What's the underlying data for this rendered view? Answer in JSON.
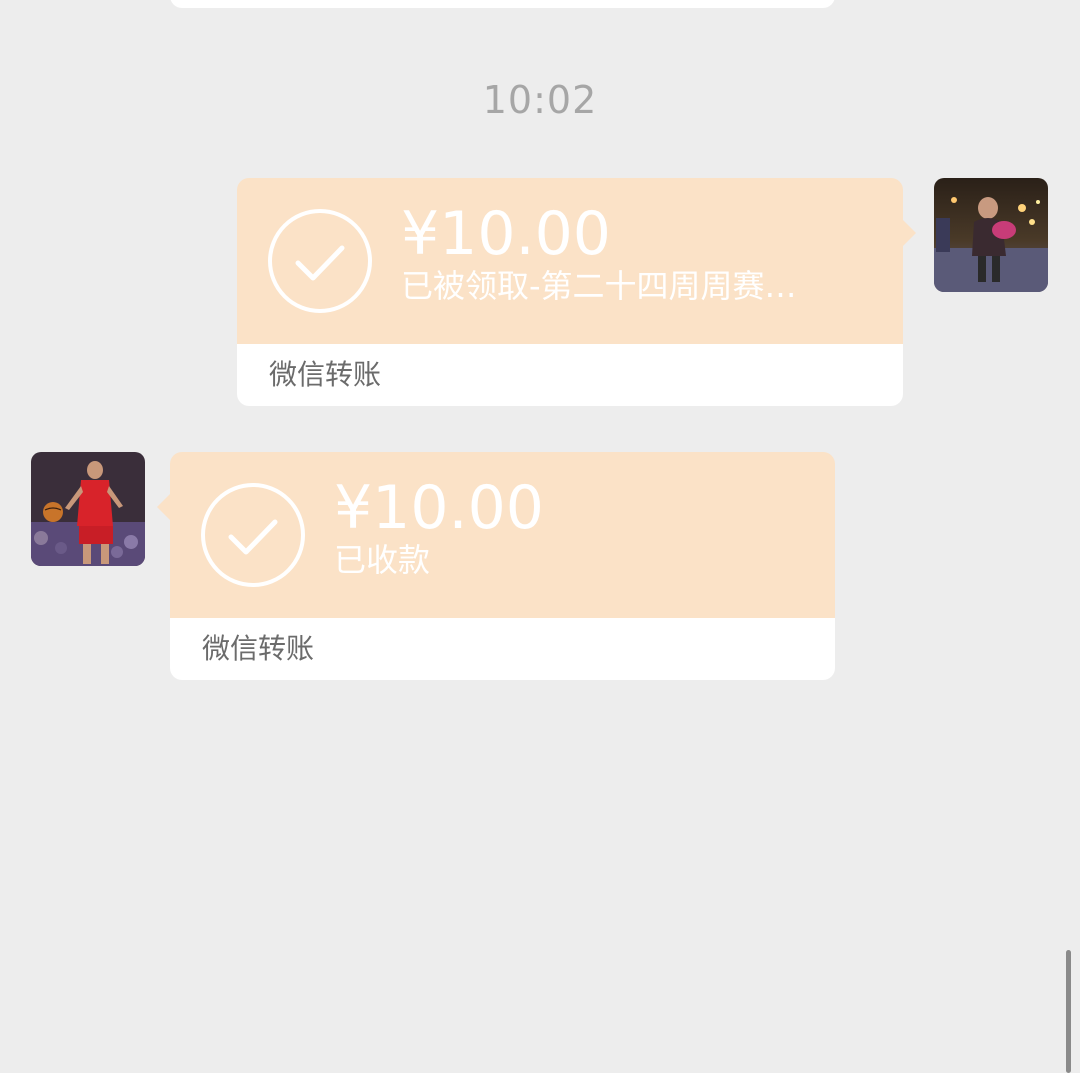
{
  "timestamp": "10:02",
  "messages": [
    {
      "direction": "sent",
      "amount": "¥10.00",
      "status": "已被领取-第二十四周周赛…",
      "footer": "微信转账",
      "avatar_icon": "avatar-photo-night-street"
    },
    {
      "direction": "received",
      "amount": "¥10.00",
      "status": "已收款",
      "footer": "微信转账",
      "avatar_icon": "avatar-photo-basketball-player"
    }
  ],
  "colors": {
    "background": "#ededed",
    "transfer_bubble": "#fbe2c7",
    "footer_bg": "#ffffff",
    "footer_text": "#6b6b6b",
    "timestamp_text": "#a6a6a6"
  }
}
